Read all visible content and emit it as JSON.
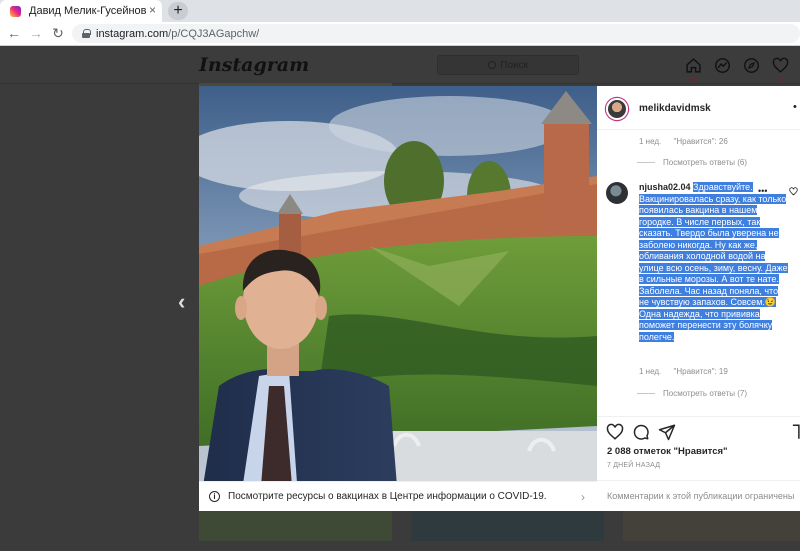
{
  "browser": {
    "tab_title": "Давид Мелик-Гусейнов (@meli",
    "tab_close": "×",
    "new_tab": "+",
    "url_host": "instagram.com",
    "url_path": "/p/CQJ3AGapchw/"
  },
  "instagram": {
    "logo": "Instagram",
    "search_placeholder": "Поиск",
    "prev_arrow": "‹"
  },
  "post": {
    "username": "melikdavidmsk",
    "more": "•",
    "reply1_meta": {
      "age": "1 нед.",
      "likes": "\"Нравится\": 26"
    },
    "reply1_view": "Посмотреть ответы (6)",
    "comment": {
      "author": "njusha02.04",
      "text": "Здравствуйте. Вакцинировалась сразу, как только появилась вакцина в нашем городке. В числе первых, так сказать. Твердо была уверена не заболею никогда. Ну как же, обливания холодной водой на улице всю осень, зиму, весну. Даже в сильные морозы. А вот те нате. Заболела. Час назад поняла, что не чувствую запахов. Совсем.😉 Одна надежда, что прививка поможет перенести эту болячку полегче.",
      "age": "1 нед.",
      "likes": "\"Нравится\": 19",
      "view_replies": "Посмотреть ответы (7)",
      "more": "•••"
    },
    "like_count": "2 088 отметок \"Нравится\"",
    "date": "7 ДНЕЙ НАЗАД",
    "comment_placeholder": "Комментарии к этой публикации ограничены"
  },
  "covid_banner": {
    "text": "Посмотрите ресурсы о вакцинах в Центре информации о COVID-19.",
    "chevron": "›"
  },
  "colors": {
    "highlight": "#3f7fe0",
    "overlay": "#3b3b3b",
    "accent": "#c13584"
  },
  "icons": [
    "favicon-icon",
    "back-icon",
    "forward-icon",
    "reload-icon",
    "lock-icon",
    "home-icon",
    "messenger-icon",
    "explore-icon",
    "heart-icon",
    "info-icon",
    "chevron-right-icon",
    "comment-icon",
    "share-icon",
    "bookmark-icon"
  ]
}
